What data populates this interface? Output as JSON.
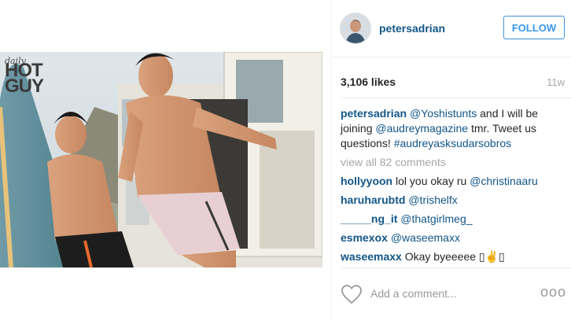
{
  "post": {
    "logo_small": "daily",
    "logo_big": "HOT GUY"
  },
  "header": {
    "username": "petersadrian",
    "follow_label": "FOLLOW"
  },
  "stats": {
    "likes": "3,106 likes",
    "time_ago": "11w"
  },
  "caption": {
    "user": "petersadrian",
    "parts": [
      "@Yoshistunts",
      " and I will be joining ",
      "@audreymagazine",
      " tmr. Tweet us questions! ",
      "#audreyasksudarsobros"
    ]
  },
  "view_all": "view all 82 comments",
  "comments": [
    {
      "user": "hollyyoon",
      "text": " lol you okay ru ",
      "mention": "@christinaaru"
    },
    {
      "user": "haruharubtd",
      "text": " ",
      "mention": "@trishelfx"
    },
    {
      "user": "_____ng_it",
      "text": " ",
      "mention": "@thatgirlmeg_"
    },
    {
      "user": "esmexox",
      "text": " ",
      "mention": "@waseemaxx"
    },
    {
      "user": "waseemaxx",
      "text": " Okay byeeeee ",
      "mention": "▯✌▯"
    }
  ],
  "add_comment": {
    "placeholder": "Add a comment...",
    "more": "ooo"
  },
  "icons": {
    "heart": "heart-outline-icon",
    "more": "more-options-icon"
  },
  "colors": {
    "link": "#125688",
    "follow": "#3897f0",
    "muted": "#a5a7aa"
  }
}
